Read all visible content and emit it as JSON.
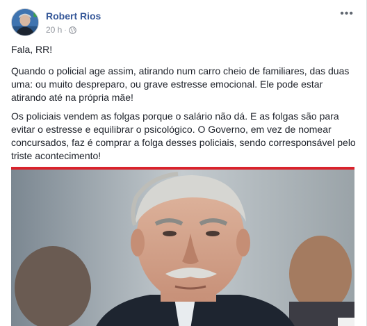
{
  "post": {
    "author": "Robert Rios",
    "time": "20 h",
    "separator": "·",
    "privacy_icon": "globe-icon",
    "more_icon": "ellipsis-icon",
    "more_label": "•••",
    "paragraphs": [
      "Fala, RR!",
      "Quando o policial age assim, atirando num carro cheio de familiares, das duas uma: ou muito despreparo, ou grave estresse emocional. Ele pode estar atirando até na própria mãe!",
      "Os policiais vendem as folgas porque o salário não dá. E as folgas são para evitar o estresse e equilibrar o psicológico. O Governo, em vez de nomear concursados, faz é comprar a folga desses policiais, sendo corresponsável pelo triste acontecimento!"
    ]
  },
  "colors": {
    "link": "#365899",
    "text": "#1d2129",
    "meta": "#90949c",
    "accent_red": "#d9232c"
  }
}
